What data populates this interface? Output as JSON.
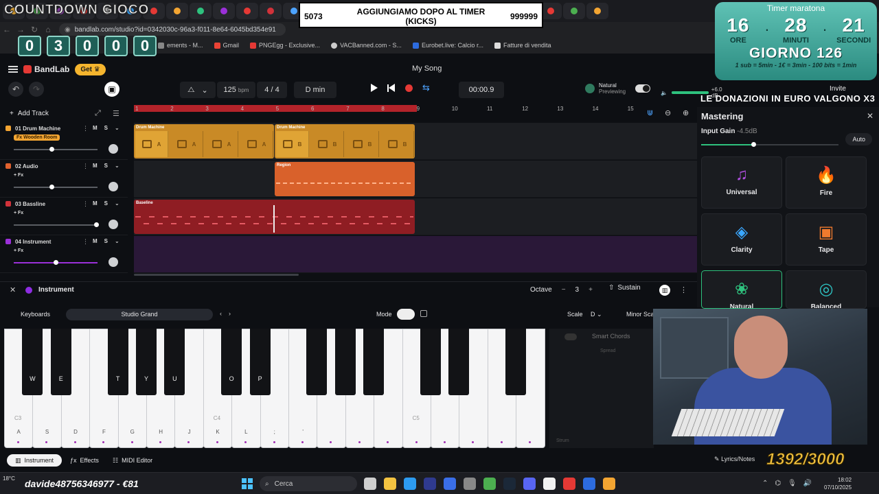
{
  "overlay": {
    "countdown_title": "COUNTDOWN GIOCO",
    "counter_digits": [
      "0",
      "3",
      "0",
      "0",
      "0"
    ],
    "kicks": {
      "left": "5073",
      "center": "AGGIUNGIAMO DOPO AL TIMER (KICKS)",
      "right": "999999"
    },
    "timer": {
      "title": "Timer maratona",
      "hours": "16",
      "hours_label": "ORE",
      "minutes": "28",
      "minutes_label": "MINUTI",
      "seconds": "21",
      "seconds_label": "SECONDI",
      "day": "GIORNO 126",
      "rules": "1 sub = 5min - 1€ = 3min - 100 bits = 1min"
    },
    "donations": "LE DONAZIONI IN EURO VALGONO X3",
    "progress_counter": "1392/3000",
    "donor_ticker": "davide48756346977 - €81"
  },
  "browser": {
    "url": "bandlab.com/studio?id=0342030c-96a3-f011-8e64-6045bd354e91",
    "bookmarks": [
      "ements - M...",
      "Gmail",
      "PNGEgg - Exclusive...",
      "VACBanned.com - S...",
      "Eurobet.live: Calcio r...",
      "Fatture di vendita"
    ]
  },
  "header": {
    "brand": "BandLab",
    "get_label": "Get",
    "song_title": "My Song",
    "invite": "Invite"
  },
  "toolbar": {
    "tempo": "125",
    "tempo_unit": "bpm",
    "time_sig": "4 / 4",
    "key": "D min",
    "time": "00:00.9",
    "natural_title": "Natural",
    "natural_sub": "Previewing",
    "volume_db": "+6.0 dB",
    "volume_level": 0.9
  },
  "tracks": {
    "add_label": "Add Track",
    "ruler": [
      "1",
      "2",
      "3",
      "4",
      "5",
      "6",
      "7",
      "8",
      "9",
      "10",
      "11",
      "12",
      "13",
      "14",
      "15"
    ],
    "items": [
      {
        "name": "01  Drum Machine",
        "fx": "Fx Wooden Room",
        "color": "#f3a532",
        "volume": 0.45
      },
      {
        "name": "02  Audio",
        "fx": "+ Fx",
        "color": "#e0612e",
        "volume": 0.45
      },
      {
        "name": "03  Bassline",
        "fx": "+ Fx",
        "color": "#d1323a",
        "volume": 0.98
      },
      {
        "name": "04  Instrument",
        "fx": "+ Fx",
        "color": "#9b30d9",
        "volume": 0.5
      }
    ],
    "regions": {
      "drum1": "Drum Machine",
      "drum2": "Drum Machine",
      "audio": "Region",
      "bass": "Baseline",
      "drum_pattern_a": "A",
      "drum_pattern_b": "B"
    }
  },
  "mastering": {
    "title": "Mastering",
    "input_gain_label": "Input Gain",
    "input_gain_value": "-4.5dB",
    "input_gain_level": 0.38,
    "auto": "Auto",
    "presets": [
      {
        "label": "Universal",
        "icon": "♫",
        "color": "#b04fe0"
      },
      {
        "label": "Fire",
        "icon": "🔥",
        "color": "#e53935"
      },
      {
        "label": "Clarity",
        "icon": "◈",
        "color": "#3aa7ff"
      },
      {
        "label": "Tape",
        "icon": "▣",
        "color": "#f07a2e"
      },
      {
        "label": "Natural",
        "icon": "❀",
        "color": "#2ec27e"
      },
      {
        "label": "Balanced",
        "icon": "◎",
        "color": "#2ec2c2"
      }
    ]
  },
  "instrument": {
    "panel_title": "Instrument",
    "octave_label": "Octave",
    "octave_value": "3",
    "sustain": "Sustain",
    "keyboards": "Keyboards",
    "preset": "Studio Grand",
    "mode": "Mode",
    "scale": "Scale",
    "scale_key": "D",
    "scale_mode": "Minor Sca",
    "smart_chords": "Smart Chords",
    "spread": "Spread",
    "strum": "Strum",
    "white_keys": [
      "A",
      "S",
      "D",
      "F",
      "G",
      "H",
      "J",
      "K",
      "L",
      ";",
      "'",
      "",
      "",
      "",
      "",
      "",
      "",
      "",
      ""
    ],
    "white_notes": [
      "C3",
      "",
      "",
      "",
      "",
      "",
      "",
      "C4",
      "",
      "",
      "",
      "",
      "",
      "",
      "C5",
      "",
      "",
      "",
      ""
    ],
    "black_keys": [
      "W",
      "E",
      "T",
      "Y",
      "U",
      "O",
      "P",
      "",
      "",
      "",
      "",
      "",
      "",
      ""
    ],
    "tabs": [
      "Instrument",
      "Effects",
      "MIDI Editor"
    ],
    "lyrics_notes": "Lyrics/Notes"
  },
  "taskbar": {
    "weather": "18°C",
    "search": "Cerca",
    "time": "18:02",
    "date": "07/10/2025"
  }
}
